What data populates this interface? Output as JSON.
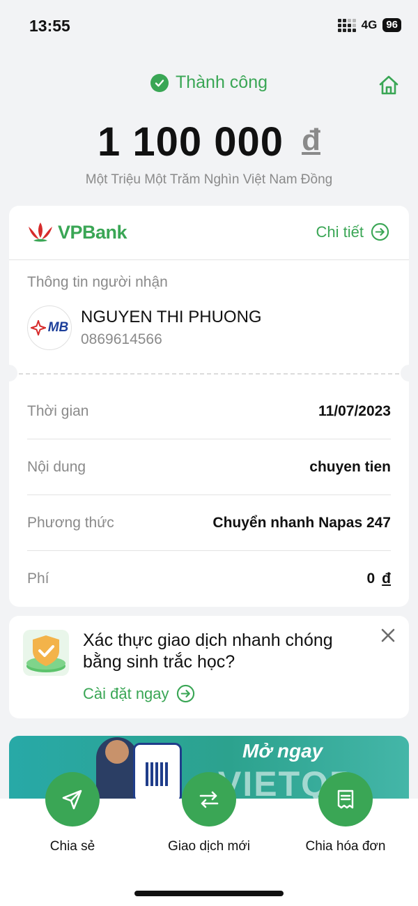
{
  "status_bar": {
    "time": "13:55",
    "network": "4G",
    "battery": "96"
  },
  "header": {
    "status_text": "Thành công"
  },
  "amount": {
    "value": "1 100 000",
    "currency": "đ",
    "in_words": "Một Triệu Một Trăm Nghìn Việt Nam Đồng"
  },
  "bank": {
    "name": "VPBank",
    "detail_label": "Chi tiết"
  },
  "recipient": {
    "section_title": "Thông tin người nhận",
    "bank_logo_text": "MB",
    "name": "NGUYEN THI PHUONG",
    "account": "0869614566"
  },
  "details": [
    {
      "label": "Thời gian",
      "value": "11/07/2023"
    },
    {
      "label": "Nội dung",
      "value": "chuyen tien"
    },
    {
      "label": "Phương thức",
      "value": "Chuyển nhanh Napas 247"
    },
    {
      "label": "Phí",
      "value": "0",
      "currency": "đ"
    }
  ],
  "biometric_promo": {
    "title": "Xác thực giao dịch nhanh chóng bằng sinh trắc học?",
    "action_label": "Cài đặt ngay"
  },
  "banner": {
    "title": "Mở ngay",
    "brand": "VIETQR"
  },
  "actions": [
    {
      "label": "Chia sẻ",
      "icon": "send-icon"
    },
    {
      "label": "Giao dịch mới",
      "icon": "swap-arrows-icon"
    },
    {
      "label": "Chia hóa đơn",
      "icon": "receipt-icon"
    }
  ],
  "colors": {
    "accent": "#3aa655",
    "background": "#f2f3f5",
    "muted_text": "#8a8a8a",
    "vpbank_red": "#d62b2b",
    "mb_blue": "#1d3f9a"
  }
}
